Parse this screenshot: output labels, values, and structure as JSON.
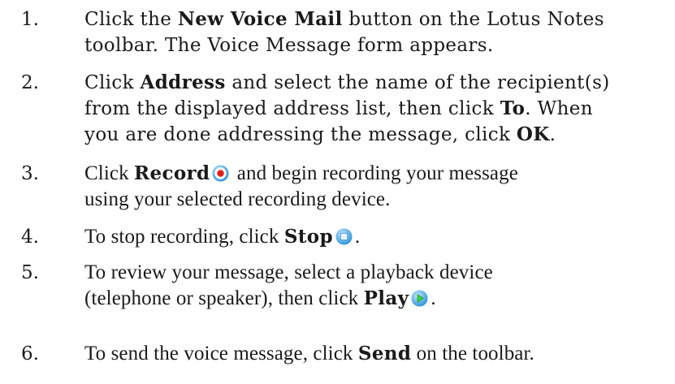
{
  "steps": [
    {
      "num": "1.",
      "l1a": "Click the ",
      "l1b": "New Voice Mail",
      "l1c": " button on the Lotus Notes",
      "l2": "toolbar. The Voice Message form appears."
    },
    {
      "num": "2.",
      "l1a": "Click ",
      "l1b": "Address",
      "l1c": " and select the name of the recipient(s)",
      "l2a": "from the displayed address list, then click ",
      "l2b": "To",
      "l2c": ". When",
      "l3a": "you are done addressing the message, click ",
      "l3b": "OK",
      "l3c": "."
    },
    {
      "num": "3.",
      "l1a": "Click ",
      "l1b": "Record",
      "l1c": " and begin recording your message",
      "icon": "record-icon",
      "l2": "using your selected recording device."
    },
    {
      "num": "4.",
      "l1a": "To stop recording, click ",
      "l1b": "Stop",
      "l1c": ".",
      "icon": "stop-icon"
    },
    {
      "num": "5.",
      "l1": "To review your message, select a playback device",
      "l2a": "(telephone or speaker), then click ",
      "l2b": "Play",
      "l2c": ".",
      "icon": "play-icon"
    },
    {
      "num": "6.",
      "l1a": "To send the voice message, click ",
      "l1b": "Send",
      "l1c": " on the toolbar."
    }
  ],
  "colors": {
    "text": "#1a1a1a",
    "icon_blue": "#2a8fd6",
    "icon_light_blue": "#7cc4f0",
    "record_red": "#e02020",
    "play_green": "#3ccf3a"
  }
}
